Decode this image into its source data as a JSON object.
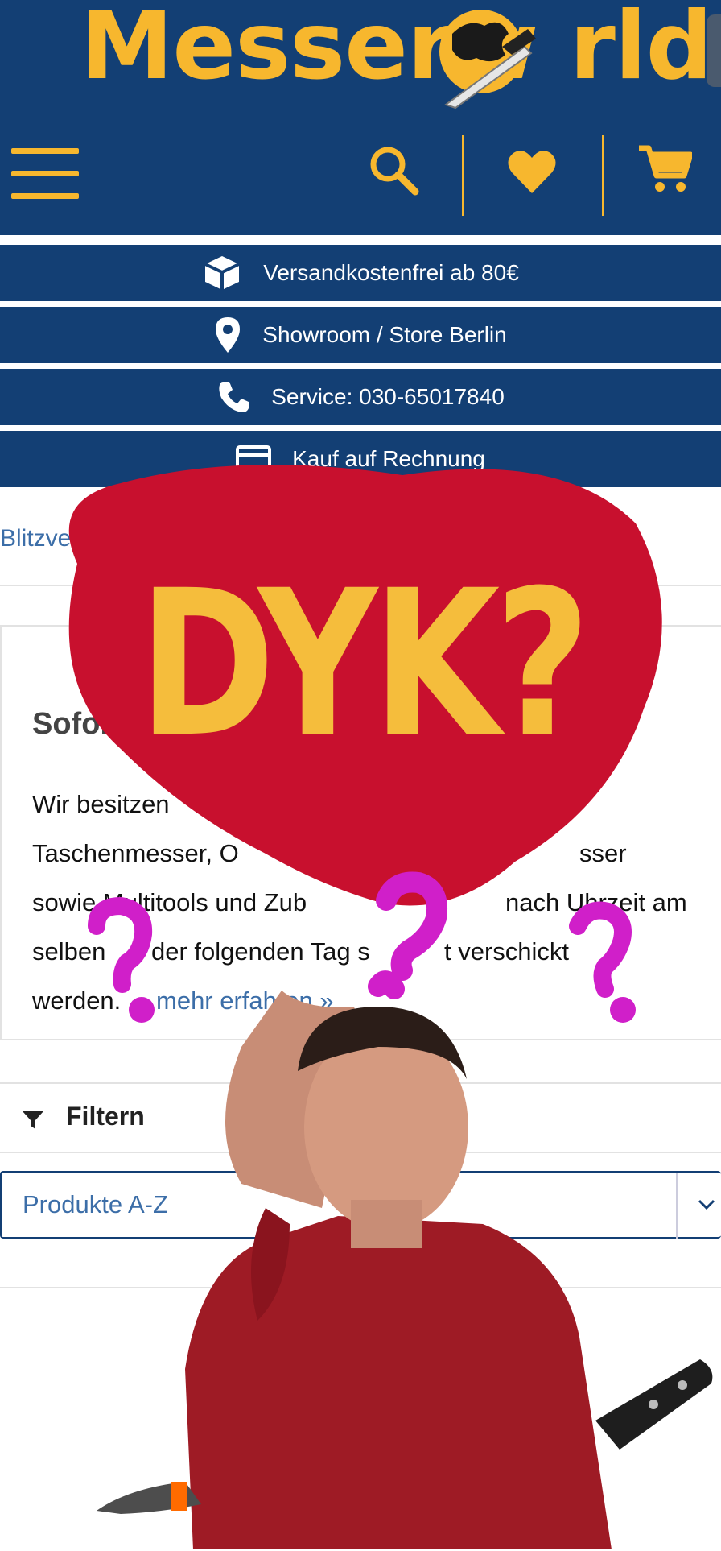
{
  "header": {
    "logo_text": "Messerw  rld",
    "icons": [
      "menu-icon",
      "search-icon",
      "heart-icon",
      "cart-icon"
    ]
  },
  "info_bars": [
    {
      "icon": "box-icon",
      "label": "Versandkostenfrei ab 80€"
    },
    {
      "icon": "location-pin-icon",
      "label": "Showroom / Store Berlin"
    },
    {
      "icon": "phone-icon",
      "label": "Service: 030-65017840"
    },
    {
      "icon": "credit-card-icon",
      "label": "Kauf auf Rechnung"
    }
  ],
  "blitz_link": "Blitzvers",
  "sofort": {
    "heading": "Sofor",
    "lines": [
      "Wir besitzen",
      "Taschenmesser, O",
      "sowie Multitools und Zub",
      "selben",
      "werden."
    ],
    "line3_tail": "nach Uhrzeit am",
    "line4_tail": "der folgenden Tag s",
    "line4_end": "t verschickt",
    "line2_tail": "sser",
    "more_link": "mehr erfahren »"
  },
  "filter": {
    "label": "Filtern",
    "icon": "filter-icon"
  },
  "sort_select": {
    "value": "Produkte A-Z",
    "icon": "chevron-down-icon"
  },
  "overlay": {
    "bubble_text": "DYK?",
    "colors": {
      "bubble": "#c8102e",
      "text": "#f5bd3c",
      "question_marks": "#d01fc9",
      "header": "#133f74",
      "accent": "#f7b72e"
    }
  }
}
